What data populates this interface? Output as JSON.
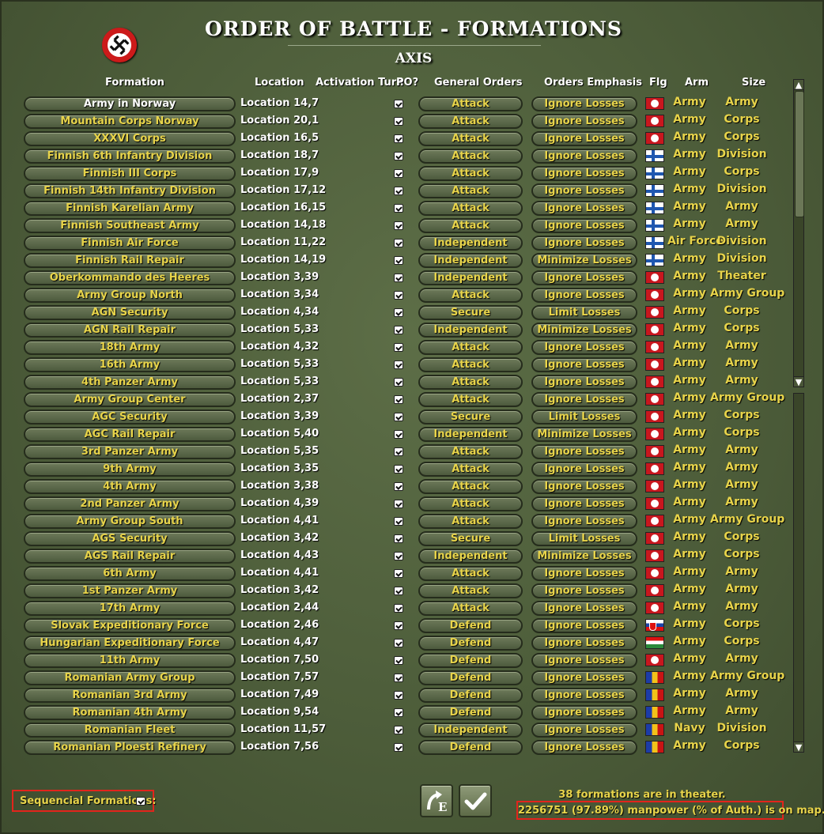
{
  "header": {
    "title": "ORDER OF BATTLE - FORMATIONS",
    "side": "AXIS",
    "emblem_icon": "swastika-emblem-icon"
  },
  "columns": {
    "formation": "Formation",
    "location": "Location",
    "activation": "Activation Turn",
    "po": "PO?",
    "general_orders": "General Orders",
    "orders_emphasis": "Orders Emphasis",
    "flag": "Flg",
    "arm": "Arm",
    "size": "Size"
  },
  "colors": {
    "label_yellow": "#e8d44a",
    "highlight_red": "#e2241c",
    "panel_green": "#4d5d3a"
  },
  "rows": [
    {
      "formation": "Army in Norway",
      "location": "Location 14,7",
      "po": true,
      "orders": "Attack",
      "emphasis": "Ignore Losses",
      "flag": "german",
      "arm": "Army",
      "size": "Army",
      "selected": true
    },
    {
      "formation": "Mountain Corps Norway",
      "location": "Location 20,1",
      "po": true,
      "orders": "Attack",
      "emphasis": "Ignore Losses",
      "flag": "german",
      "arm": "Army",
      "size": "Corps"
    },
    {
      "formation": "XXXVI Corps",
      "location": "Location 16,5",
      "po": true,
      "orders": "Attack",
      "emphasis": "Ignore Losses",
      "flag": "german",
      "arm": "Army",
      "size": "Corps"
    },
    {
      "formation": "Finnish 6th Infantry Division",
      "location": "Location 18,7",
      "po": true,
      "orders": "Attack",
      "emphasis": "Ignore Losses",
      "flag": "finnish",
      "arm": "Army",
      "size": "Division"
    },
    {
      "formation": "Finnish III Corps",
      "location": "Location 17,9",
      "po": true,
      "orders": "Attack",
      "emphasis": "Ignore Losses",
      "flag": "finnish",
      "arm": "Army",
      "size": "Corps"
    },
    {
      "formation": "Finnish 14th Infantry Division",
      "location": "Location 17,12",
      "po": true,
      "orders": "Attack",
      "emphasis": "Ignore Losses",
      "flag": "finnish",
      "arm": "Army",
      "size": "Division"
    },
    {
      "formation": "Finnish Karelian Army",
      "location": "Location 16,15",
      "po": true,
      "orders": "Attack",
      "emphasis": "Ignore Losses",
      "flag": "finnish",
      "arm": "Army",
      "size": "Army"
    },
    {
      "formation": "Finnish Southeast Army",
      "location": "Location 14,18",
      "po": true,
      "orders": "Attack",
      "emphasis": "Ignore Losses",
      "flag": "finnish",
      "arm": "Army",
      "size": "Army"
    },
    {
      "formation": "Finnish Air Force",
      "location": "Location 11,22",
      "po": true,
      "orders": "Independent",
      "emphasis": "Ignore Losses",
      "flag": "finnish",
      "arm": "Air Force",
      "size": "Division"
    },
    {
      "formation": "Finnish Rail Repair",
      "location": "Location 14,19",
      "po": true,
      "orders": "Independent",
      "emphasis": "Minimize Losses",
      "flag": "finnish",
      "arm": "Army",
      "size": "Division"
    },
    {
      "formation": "Oberkommando des Heeres",
      "location": "Location 3,39",
      "po": true,
      "orders": "Independent",
      "emphasis": "Ignore Losses",
      "flag": "german",
      "arm": "Army",
      "size": "Theater"
    },
    {
      "formation": "Army Group North",
      "location": "Location 3,34",
      "po": true,
      "orders": "Attack",
      "emphasis": "Ignore Losses",
      "flag": "german",
      "arm": "Army",
      "size": "Army Group"
    },
    {
      "formation": "AGN Security",
      "location": "Location 4,34",
      "po": true,
      "orders": "Secure",
      "emphasis": "Limit Losses",
      "flag": "german",
      "arm": "Army",
      "size": "Corps"
    },
    {
      "formation": "AGN Rail Repair",
      "location": "Location 5,33",
      "po": true,
      "orders": "Independent",
      "emphasis": "Minimize Losses",
      "flag": "german",
      "arm": "Army",
      "size": "Corps"
    },
    {
      "formation": "18th Army",
      "location": "Location 4,32",
      "po": true,
      "orders": "Attack",
      "emphasis": "Ignore Losses",
      "flag": "german",
      "arm": "Army",
      "size": "Army"
    },
    {
      "formation": "16th Army",
      "location": "Location 5,33",
      "po": true,
      "orders": "Attack",
      "emphasis": "Ignore Losses",
      "flag": "german",
      "arm": "Army",
      "size": "Army"
    },
    {
      "formation": "4th Panzer Army",
      "location": "Location 5,33",
      "po": true,
      "orders": "Attack",
      "emphasis": "Ignore Losses",
      "flag": "german",
      "arm": "Army",
      "size": "Army"
    },
    {
      "formation": "Army Group Center",
      "location": "Location 2,37",
      "po": true,
      "orders": "Attack",
      "emphasis": "Ignore Losses",
      "flag": "german",
      "arm": "Army",
      "size": "Army Group"
    },
    {
      "formation": "AGC Security",
      "location": "Location 3,39",
      "po": true,
      "orders": "Secure",
      "emphasis": "Limit Losses",
      "flag": "german",
      "arm": "Army",
      "size": "Corps"
    },
    {
      "formation": "AGC Rail Repair",
      "location": "Location 5,40",
      "po": true,
      "orders": "Independent",
      "emphasis": "Minimize Losses",
      "flag": "german",
      "arm": "Army",
      "size": "Corps"
    },
    {
      "formation": "3rd Panzer Army",
      "location": "Location 5,35",
      "po": true,
      "orders": "Attack",
      "emphasis": "Ignore Losses",
      "flag": "german",
      "arm": "Army",
      "size": "Army"
    },
    {
      "formation": "9th Army",
      "location": "Location 3,35",
      "po": true,
      "orders": "Attack",
      "emphasis": "Ignore Losses",
      "flag": "german",
      "arm": "Army",
      "size": "Army"
    },
    {
      "formation": "4th Army",
      "location": "Location 3,38",
      "po": true,
      "orders": "Attack",
      "emphasis": "Ignore Losses",
      "flag": "german",
      "arm": "Army",
      "size": "Army"
    },
    {
      "formation": "2nd Panzer Army",
      "location": "Location 4,39",
      "po": true,
      "orders": "Attack",
      "emphasis": "Ignore Losses",
      "flag": "german",
      "arm": "Army",
      "size": "Army"
    },
    {
      "formation": "Army Group South",
      "location": "Location 4,41",
      "po": true,
      "orders": "Attack",
      "emphasis": "Ignore Losses",
      "flag": "german",
      "arm": "Army",
      "size": "Army Group"
    },
    {
      "formation": "AGS Security",
      "location": "Location 3,42",
      "po": true,
      "orders": "Secure",
      "emphasis": "Limit Losses",
      "flag": "german",
      "arm": "Army",
      "size": "Corps"
    },
    {
      "formation": "AGS Rail Repair",
      "location": "Location 4,43",
      "po": true,
      "orders": "Independent",
      "emphasis": "Minimize Losses",
      "flag": "german",
      "arm": "Army",
      "size": "Corps"
    },
    {
      "formation": "6th Army",
      "location": "Location 4,41",
      "po": true,
      "orders": "Attack",
      "emphasis": "Ignore Losses",
      "flag": "german",
      "arm": "Army",
      "size": "Army"
    },
    {
      "formation": "1st Panzer Army",
      "location": "Location 3,42",
      "po": true,
      "orders": "Attack",
      "emphasis": "Ignore Losses",
      "flag": "german",
      "arm": "Army",
      "size": "Army"
    },
    {
      "formation": "17th Army",
      "location": "Location 2,44",
      "po": true,
      "orders": "Attack",
      "emphasis": "Ignore Losses",
      "flag": "german",
      "arm": "Army",
      "size": "Army"
    },
    {
      "formation": "Slovak Expeditionary Force",
      "location": "Location 2,46",
      "po": true,
      "orders": "Defend",
      "emphasis": "Ignore Losses",
      "flag": "slovak",
      "arm": "Army",
      "size": "Corps"
    },
    {
      "formation": "Hungarian Expeditionary Force",
      "location": "Location 4,47",
      "po": true,
      "orders": "Defend",
      "emphasis": "Ignore Losses",
      "flag": "hungarian",
      "arm": "Army",
      "size": "Corps"
    },
    {
      "formation": "11th Army",
      "location": "Location 7,50",
      "po": true,
      "orders": "Defend",
      "emphasis": "Ignore Losses",
      "flag": "german",
      "arm": "Army",
      "size": "Army"
    },
    {
      "formation": "Romanian Army Group",
      "location": "Location 7,57",
      "po": true,
      "orders": "Defend",
      "emphasis": "Ignore Losses",
      "flag": "romanian",
      "arm": "Army",
      "size": "Army Group"
    },
    {
      "formation": "Romanian 3rd Army",
      "location": "Location 7,49",
      "po": true,
      "orders": "Defend",
      "emphasis": "Ignore Losses",
      "flag": "romanian",
      "arm": "Army",
      "size": "Army"
    },
    {
      "formation": "Romanian 4th Army",
      "location": "Location 9,54",
      "po": true,
      "orders": "Defend",
      "emphasis": "Ignore Losses",
      "flag": "romanian",
      "arm": "Army",
      "size": "Army"
    },
    {
      "formation": "Romanian Fleet",
      "location": "Location 11,57",
      "po": true,
      "orders": "Independent",
      "emphasis": "Ignore Losses",
      "flag": "romanian",
      "arm": "Navy",
      "size": "Division"
    },
    {
      "formation": "Romanian Ploesti Refinery",
      "location": "Location 7,56",
      "po": true,
      "orders": "Defend",
      "emphasis": "Ignore Losses",
      "flag": "romanian",
      "arm": "Army",
      "size": "Corps"
    }
  ],
  "footer": {
    "sequential_label": "Sequencial Formations:",
    "sequential_checked": true,
    "export_button_label": "E",
    "confirm_icon": "checkmark-icon",
    "formations_count_text": "38 formations are in theater.",
    "manpower_text": "2256751 (97.89%) manpower (% of Auth.) is on map."
  }
}
